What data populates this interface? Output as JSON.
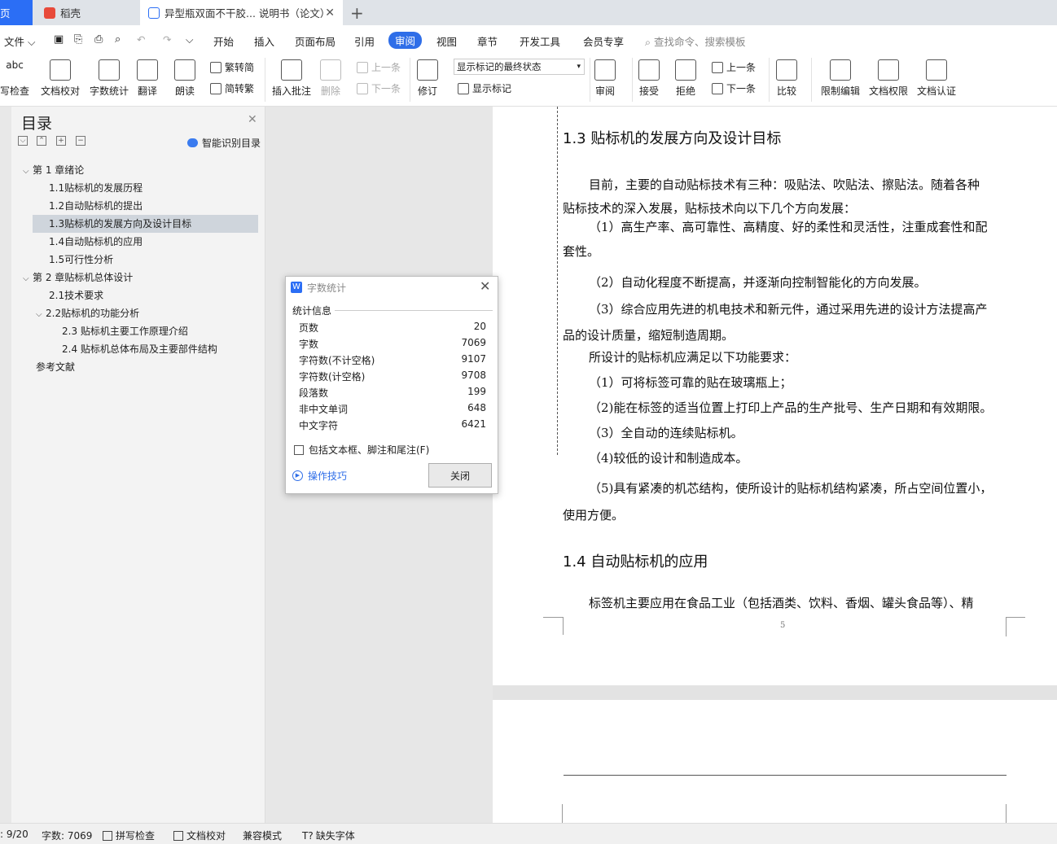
{
  "tabs": {
    "home": "页",
    "daoke": "稻壳",
    "doc": "异型瓶双面不干胶... 说明书（论文）"
  },
  "menu": {
    "file": "文件",
    "items": [
      "开始",
      "插入",
      "页面布局",
      "引用",
      "审阅",
      "视图",
      "章节",
      "开发工具",
      "会员专享"
    ],
    "search": "查找命令、搜索模板"
  },
  "ribbon": {
    "spellcheck": "写检查",
    "abc": "abc",
    "doccheck": "文档校对",
    "wordcount": "字数统计",
    "translate": "翻译",
    "read": "朗读",
    "trad": "繁转简",
    "simp": "简转繁",
    "insert_comment": "插入批注",
    "delete": "删除",
    "prev": "上一条",
    "next": "下一条",
    "track": "修订",
    "markup_state": "显示标记的最终状态",
    "show_markup": "显示标记",
    "review": "审阅",
    "accept": "接受",
    "reject": "拒绝",
    "prev2": "上一条",
    "next2": "下一条",
    "compare": "比较",
    "restrict": "限制编辑",
    "rights": "文档权限",
    "cert": "文档认证"
  },
  "toc": {
    "title": "目录",
    "smart": "智能识别目录",
    "items": [
      "第 1 章绪论",
      "1.1贴标机的发展历程",
      "1.2自动贴标机的提出",
      "1.3贴标机的发展方向及设计目标",
      "1.4自动贴标机的应用",
      "1.5可行性分析",
      "第 2 章贴标机总体设计",
      "2.1技术要求",
      "2.2贴标机的功能分析",
      "2.3 贴标机主要工作原理介绍",
      "2.4  贴标机总体布局及主要部件结构",
      "参考文献"
    ]
  },
  "doc": {
    "h13": "1.3 贴标机的发展方向及设计目标",
    "p1a": "目前，主要的自动贴标技术有三种：吸贴法、吹贴法、擦贴法。随着各种",
    "p1b": "贴标技术的深入发展，贴标技术向以下几个方向发展：",
    "p2a": "（1）高生产率、高可靠性、高精度、好的柔性和灵活性，注重成套性和配",
    "p2b": "套性。",
    "p3": "（2）自动化程度不断提高，并逐渐向控制智能化的方向发展。",
    "p4a": "（3）综合应用先进的机电技术和新元件，通过采用先进的设计方法提高产",
    "p4b": "品的设计质量，缩短制造周期。",
    "p5": "所设计的贴标机应满足以下功能要求：",
    "p6": "（1）可将标签可靠的贴在玻璃瓶上；",
    "p7": "（2)能在标签的适当位置上打印上产品的生产批号、生产日期和有效期限。",
    "p8": "（3）全自动的连续贴标机。",
    "p9": "（4)较低的设计和制造成本。",
    "p10a": "（5)具有紧凑的机芯结构，使所设计的贴标机结构紧凑，所占空间位置小，",
    "p10b": "使用方便。",
    "h14": "1.4 自动贴标机的应用",
    "p11": "标签机主要应用在食品工业（包括酒类、饮料、香烟、罐头食品等）、精",
    "pagenum": "5"
  },
  "dialog": {
    "title": "字数统计",
    "group": "统计信息",
    "rows": [
      {
        "label": "页数",
        "value": "20"
      },
      {
        "label": "字数",
        "value": "7069"
      },
      {
        "label": "字符数(不计空格)",
        "value": "9107"
      },
      {
        "label": "字符数(计空格)",
        "value": "9708"
      },
      {
        "label": "段落数",
        "value": "199"
      },
      {
        "label": "非中文单词",
        "value": "648"
      },
      {
        "label": "中文字符",
        "value": "6421"
      }
    ],
    "checkbox": "包括文本框、脚注和尾注(F)",
    "tips": "操作技巧",
    "close": "关闭"
  },
  "status": {
    "page": ": 9/20",
    "words": "字数: 7069",
    "spell": "拼写检查",
    "proof": "文档校对",
    "compat": "兼容模式",
    "font": "缺失字体"
  },
  "colors": {
    "accent": "#2f6ee8",
    "tab_home": "#2b6ef5"
  }
}
